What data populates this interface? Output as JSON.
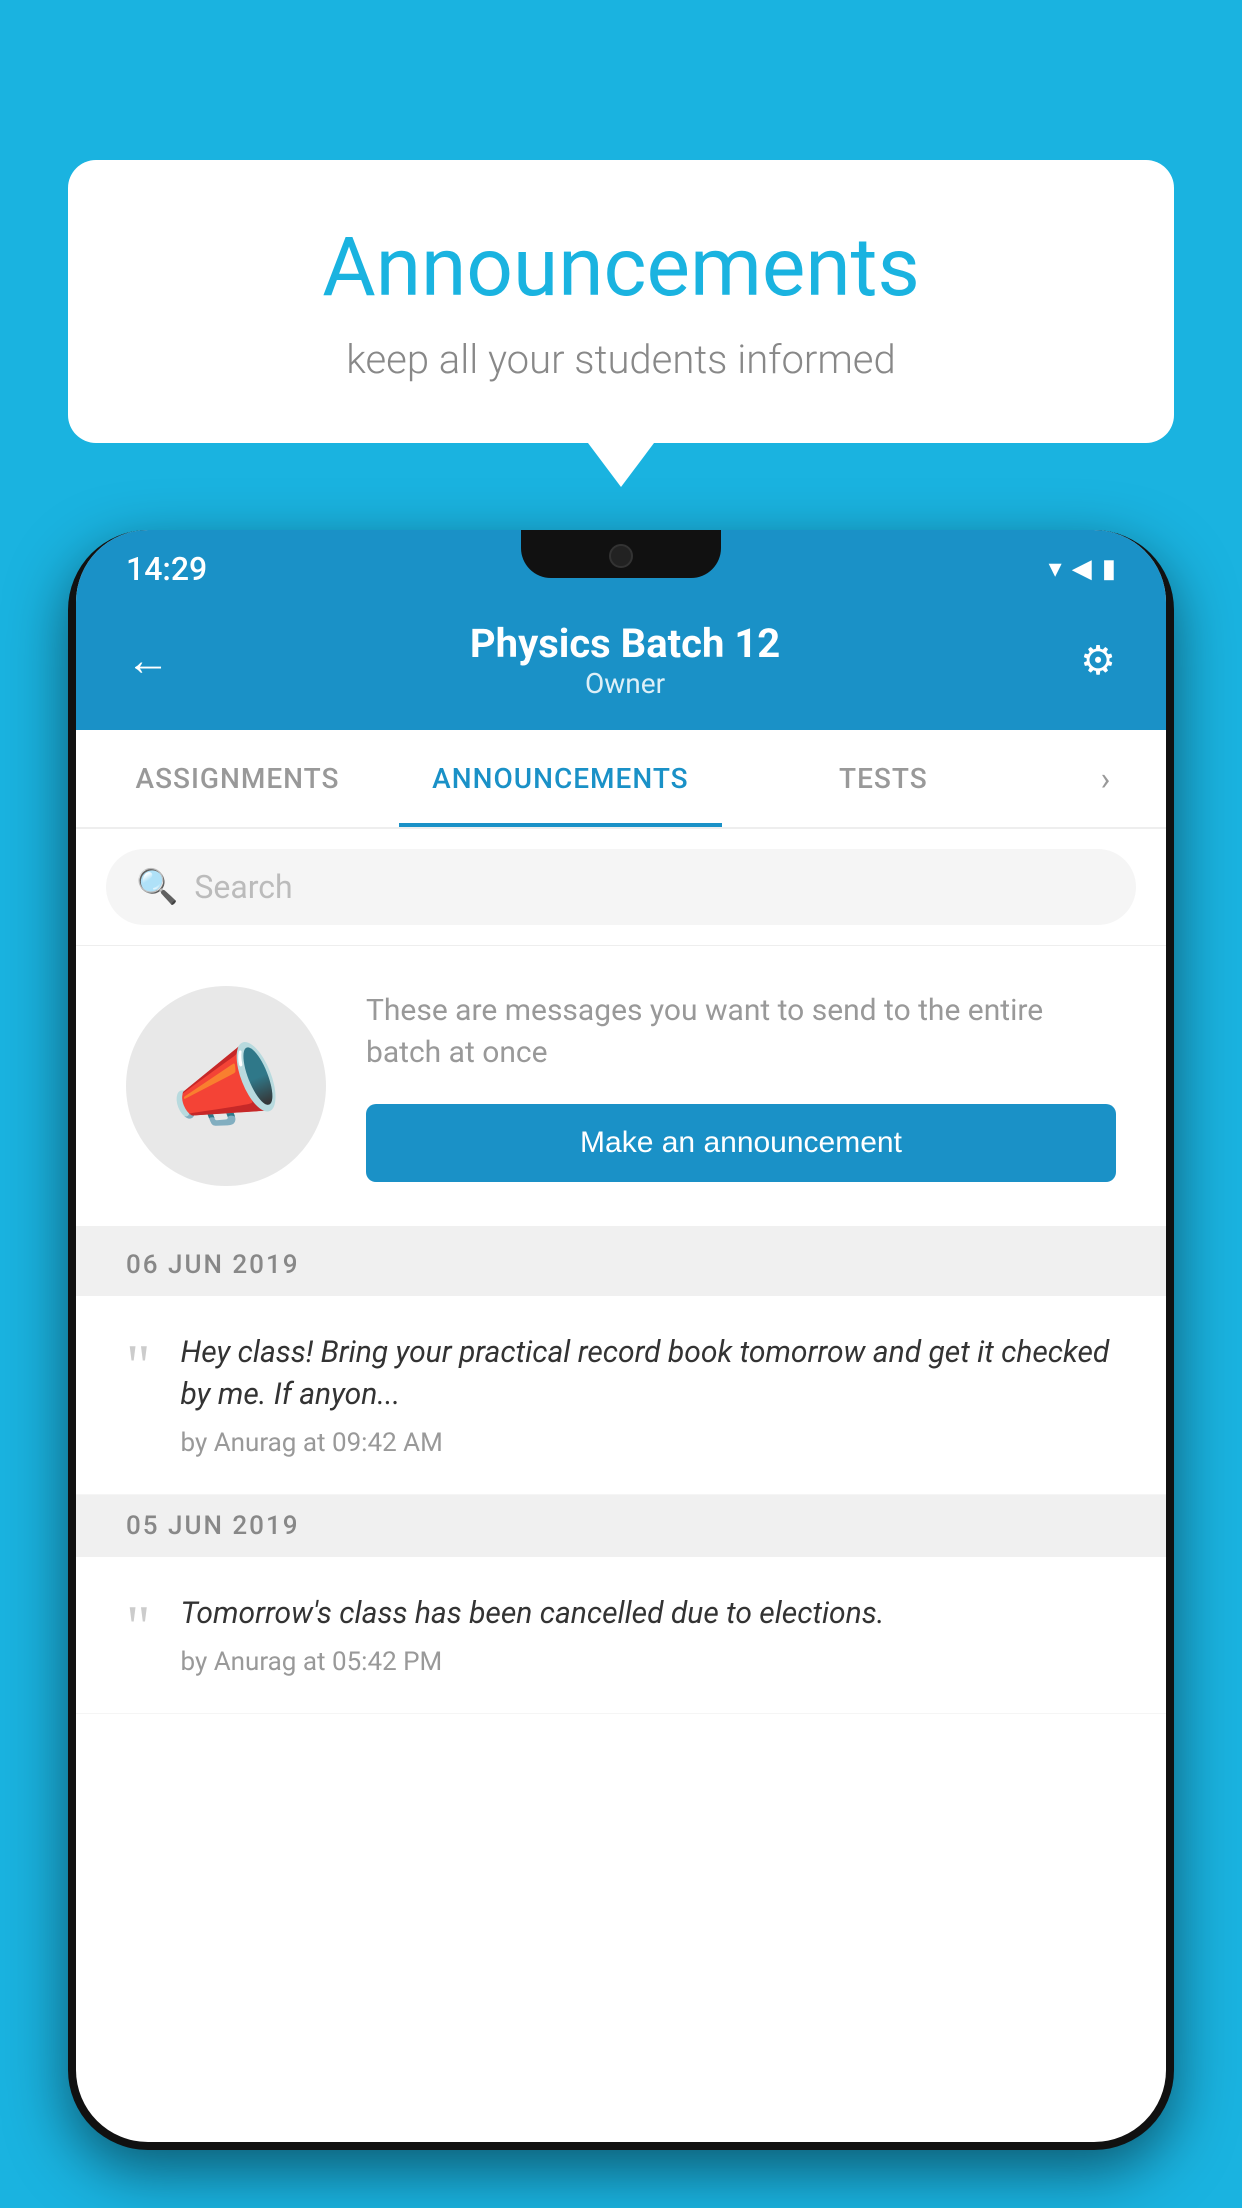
{
  "background_color": "#1ab3e0",
  "speech_bubble": {
    "title": "Announcements",
    "subtitle": "keep all your students informed"
  },
  "phone": {
    "status_bar": {
      "time": "14:29",
      "icons": [
        "wifi",
        "signal",
        "battery"
      ]
    },
    "header": {
      "title": "Physics Batch 12",
      "subtitle": "Owner",
      "back_label": "←",
      "settings_label": "⚙"
    },
    "tabs": [
      {
        "label": "ASSIGNMENTS",
        "active": false
      },
      {
        "label": "ANNOUNCEMENTS",
        "active": true
      },
      {
        "label": "TESTS",
        "active": false
      }
    ],
    "search": {
      "placeholder": "Search"
    },
    "announcement_prompt": {
      "description": "These are messages you want to send to the entire batch at once",
      "button_label": "Make an announcement"
    },
    "announcements": [
      {
        "date": "06  JUN  2019",
        "items": [
          {
            "text": "Hey class! Bring your practical record book tomorrow and get it checked by me. If anyon...",
            "meta": "by Anurag at 09:42 AM"
          }
        ]
      },
      {
        "date": "05  JUN  2019",
        "items": [
          {
            "text": "Tomorrow's class has been cancelled due to elections.",
            "meta": "by Anurag at 05:42 PM"
          }
        ]
      }
    ]
  }
}
